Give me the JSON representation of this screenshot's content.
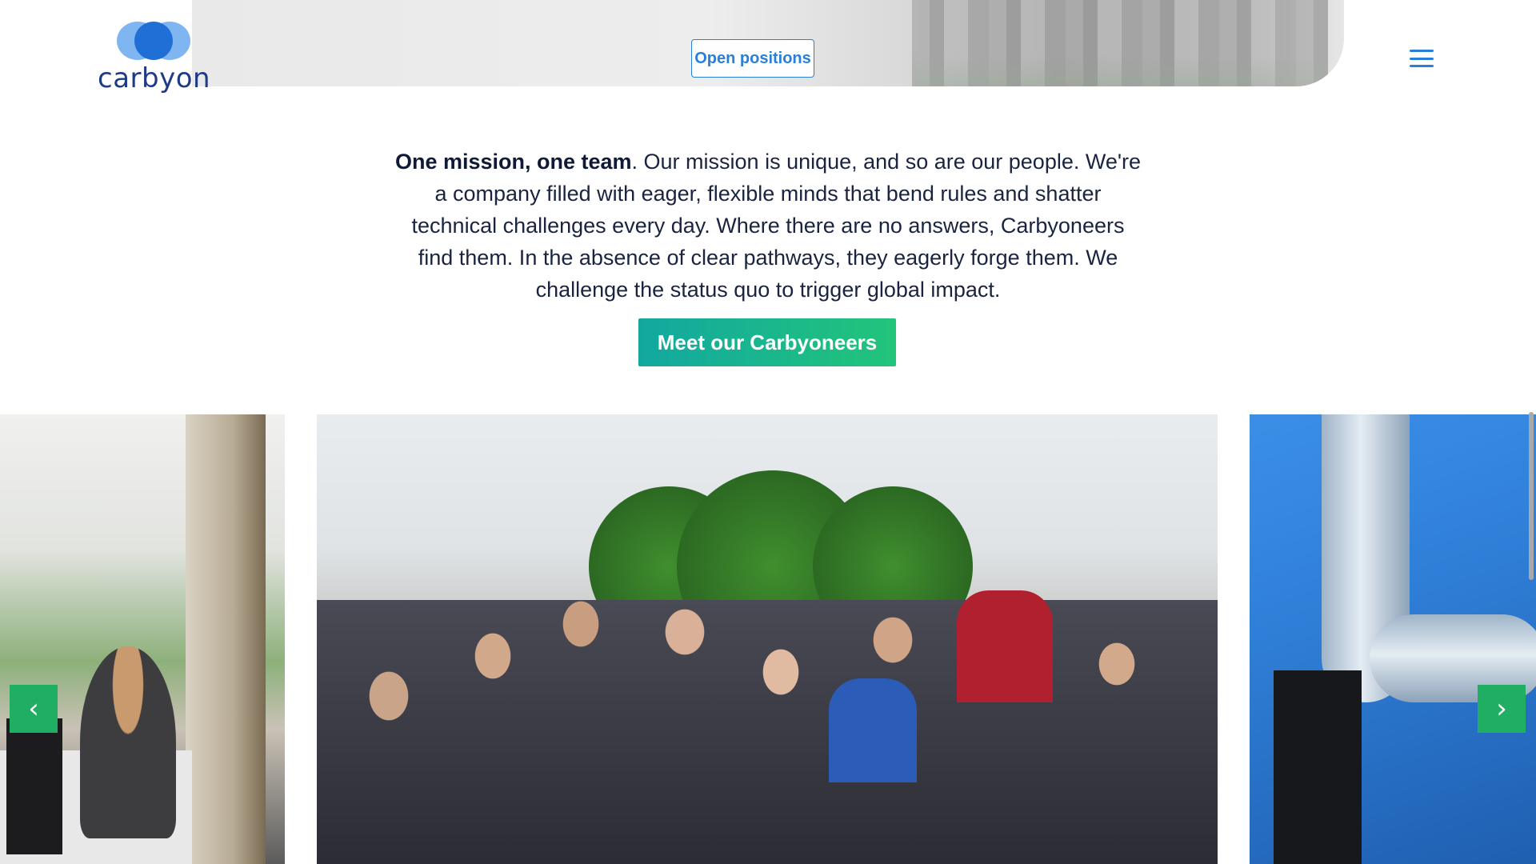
{
  "brand": {
    "name": "carbyon",
    "colors": {
      "primary_blue": "#2a7fd8",
      "ring_light": "#7fb6f2",
      "ring_dark": "#1f6fd6",
      "wordmark": "#1f3b86"
    }
  },
  "header": {
    "open_positions_label": "Open positions",
    "menu_icon": "hamburger-menu-icon"
  },
  "mission": {
    "lead": "One mission, one team",
    "body": ". Our mission is unique, and so are our people. We're a company filled with eager, flexible minds that bend rules and shatter technical challenges every day. Where there are no answers, Carbyoneers find them. In the absence of clear pathways, they eagerly forge them. We challenge the status quo to trigger global impact."
  },
  "cta": {
    "label": "Meet our Carbyoneers",
    "gradient_start": "#12a8a0",
    "gradient_end": "#22c47a"
  },
  "carousel": {
    "prev_icon": "chevron-left-icon",
    "next_icon": "chevron-right-icon",
    "prev_glyph": "‹",
    "next_glyph": "›",
    "arrow_color": "#1fae62"
  }
}
